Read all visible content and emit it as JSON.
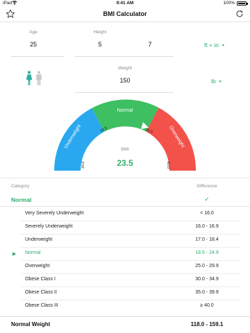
{
  "status": {
    "carrier": "iPad",
    "time": "9:41 AM",
    "battery": "100%"
  },
  "nav": {
    "title": "BMI Calculator",
    "favorite_icon": "star-icon",
    "refresh_icon": "refresh-icon"
  },
  "inputs": {
    "age": {
      "label": "Age",
      "value": "25"
    },
    "height": {
      "label": "Height",
      "feet": "5",
      "inches": "7",
      "unit": "ft + in"
    },
    "weight": {
      "label": "Weight",
      "value": "150",
      "unit": "lb"
    },
    "gender_icons": [
      "female-icon",
      "male-icon"
    ]
  },
  "gauge": {
    "label": "BMI",
    "value": "23.5",
    "segments": [
      {
        "label": "Underweight",
        "color": "#29a8f0"
      },
      {
        "label": "Normal",
        "color": "#3dbf62"
      },
      {
        "label": "Overweight",
        "color": "#f2524a"
      }
    ],
    "ticks": [
      "16.0",
      "18.5",
      "25.0",
      "40.0"
    ]
  },
  "table": {
    "header_category": "Category",
    "header_difference": "Difference",
    "current_category": "Normal",
    "current_check": "✓",
    "rows": [
      {
        "name": "Very Severely Underweight",
        "range": "< 16.0"
      },
      {
        "name": "Severely Underweight",
        "range": "16.0 - 16.9"
      },
      {
        "name": "Underweight",
        "range": "17.0 - 18.4"
      },
      {
        "name": "Normal",
        "range": "18.5 - 24.9",
        "active": true
      },
      {
        "name": "Overweight",
        "range": "25.0 - 29.9"
      },
      {
        "name": "Obese Class I",
        "range": "30.0 - 34.9"
      },
      {
        "name": "Obese Class II",
        "range": "35.0 - 39.9"
      },
      {
        "name": "Obese Class III",
        "range": "≥ 40.0"
      }
    ]
  },
  "footer": {
    "label": "Normal Weight",
    "value": "118.0 - 159.1"
  },
  "colors": {
    "accent": "#2fae6e",
    "underweight": "#29a8f0",
    "normal": "#3dbf62",
    "overweight": "#f2524a"
  }
}
